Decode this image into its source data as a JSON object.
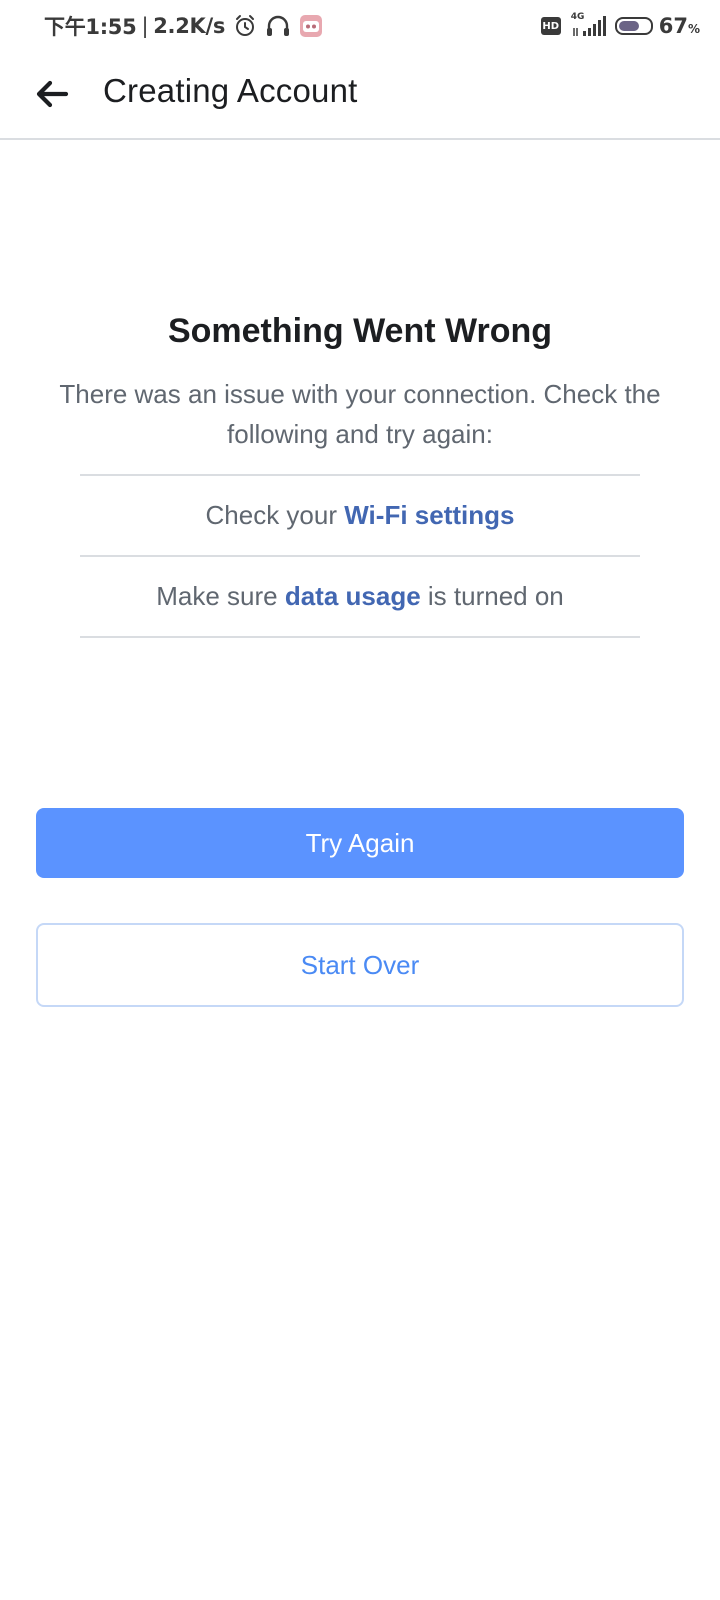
{
  "status_bar": {
    "time": "下午1:55",
    "separator": "|",
    "speed": "2.2K/s",
    "hd_badge": "HD",
    "network_type": "4G",
    "battery_percent": "67",
    "battery_unit": "%",
    "battery_level": 0.67,
    "icons": [
      "alarm-icon",
      "headphones-icon",
      "app-notification-icon",
      "signal-icon",
      "battery-icon"
    ]
  },
  "header": {
    "title": "Creating Account",
    "back_icon": "back-arrow-icon"
  },
  "error": {
    "title": "Something Went Wrong",
    "message": "There was an issue with your connection. Check the following and try again:",
    "items": [
      {
        "prefix": "Check your",
        "link": "Wi-Fi settings",
        "suffix": ""
      },
      {
        "prefix": "Make sure",
        "link": "data usage",
        "suffix": "is turned on"
      }
    ]
  },
  "buttons": {
    "primary": "Try Again",
    "secondary": "Start Over"
  },
  "colors": {
    "primary_button": "#5b93ff",
    "link": "#4267b2",
    "secondary_text": "#4a8af4",
    "secondary_border": "#c5d8f7"
  }
}
